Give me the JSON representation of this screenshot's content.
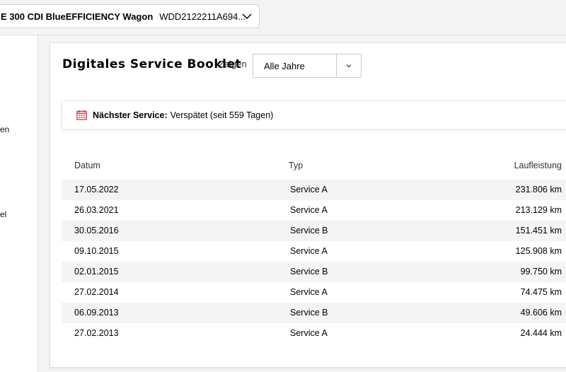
{
  "vehicle": {
    "name": "E 300 CDI BlueEFFICIENCY Wagon",
    "vin": "WDD2122211A694..."
  },
  "sidebar": {
    "items": [
      {
        "label": "en"
      },
      {
        "label": "el"
      }
    ]
  },
  "booklet": {
    "title": "Digitales Service Booklet",
    "show_label": "Zeigen",
    "year_filter": "Alle Jahre"
  },
  "next_service": {
    "label": "Nächster Service:",
    "value": "Verspätet (seit 559 Tagen)"
  },
  "table": {
    "headers": {
      "date": "Datum",
      "type": "Typ",
      "mileage": "Laufleistung"
    },
    "rows": [
      {
        "date": "17.05.2022",
        "type": "Service A",
        "mileage": "231.806 km"
      },
      {
        "date": "26.03.2021",
        "type": "Service A",
        "mileage": "213.129 km"
      },
      {
        "date": "30.05.2016",
        "type": "Service B",
        "mileage": "151.451 km"
      },
      {
        "date": "09.10.2015",
        "type": "Service A",
        "mileage": "125.908 km"
      },
      {
        "date": "02.01.2015",
        "type": "Service B",
        "mileage": "99.750 km"
      },
      {
        "date": "27.02.2014",
        "type": "Service A",
        "mileage": "74.475 km"
      },
      {
        "date": "06.09.2013",
        "type": "Service B",
        "mileage": "49.606 km"
      },
      {
        "date": "27.02.2013",
        "type": "Service A",
        "mileage": "24.444 km"
      }
    ]
  },
  "colors": {
    "calendar_icon": "#d4202c",
    "row_alt": "#f4f4f4"
  }
}
